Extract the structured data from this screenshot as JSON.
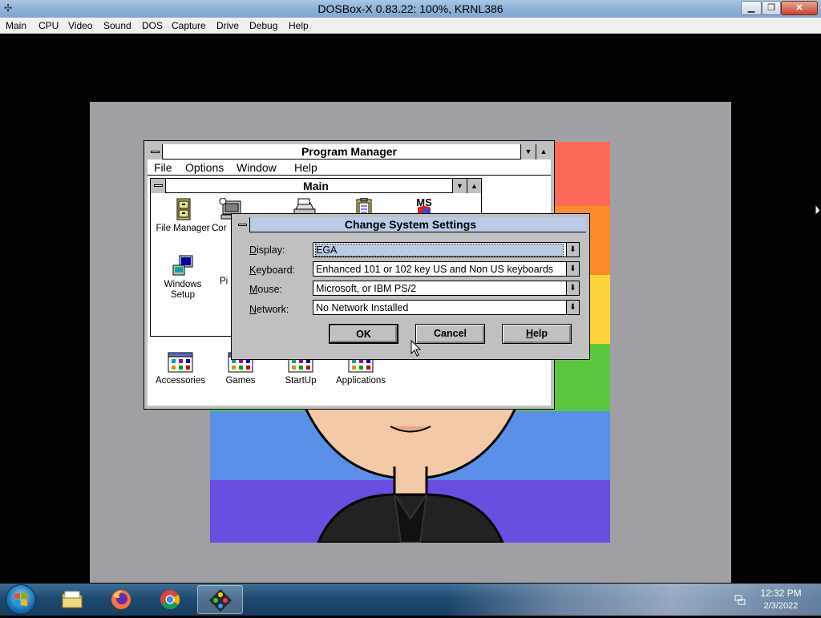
{
  "host": {
    "title": "DOSBox-X 0.83.22: 100%, KRNL386",
    "minimize_glyph": "▁",
    "maximize_glyph": "❐",
    "close_glyph": "✕",
    "menu": [
      "Main",
      "CPU",
      "Video",
      "Sound",
      "DOS",
      "Capture",
      "Drive",
      "Debug",
      "Help"
    ]
  },
  "progman": {
    "title": "Program Manager",
    "menu": [
      "File",
      "Options",
      "Window",
      "Help"
    ],
    "main_group": {
      "title": "Main",
      "icons": [
        {
          "label": "File Manager",
          "icon": "file-cabinet-icon"
        },
        {
          "label": "Cor",
          "icon": "computer-icon"
        },
        {
          "label": "",
          "icon": "printer-icon"
        },
        {
          "label": "",
          "icon": "clipboard-icon"
        },
        {
          "label": "",
          "icon": "ms-dos-icon"
        },
        {
          "label_line1": "Windows",
          "label_line2": "Setup",
          "icon": "windows-setup-icon"
        },
        {
          "label": "Pi",
          "icon": "pif-editor-icon"
        }
      ],
      "ms_dos_text": "MS"
    },
    "groups": [
      {
        "label": "Accessories",
        "icon": "program-group-icon"
      },
      {
        "label": "Games",
        "icon": "program-group-icon"
      },
      {
        "label": "StartUp",
        "icon": "program-group-icon"
      },
      {
        "label": "Applications",
        "icon": "program-group-icon"
      }
    ]
  },
  "dialog": {
    "title": "Change System Settings",
    "fields": [
      {
        "label_u": "D",
        "label_rest": "isplay:",
        "value": "EGA"
      },
      {
        "label_u": "K",
        "label_rest": "eyboard:",
        "value": "Enhanced 101 or 102 key US and Non US keyboards"
      },
      {
        "label_u": "M",
        "label_rest": "ouse:",
        "value": "Microsoft, or IBM PS/2"
      },
      {
        "label_u": "N",
        "label_rest": "etwork:",
        "value": "No Network Installed"
      }
    ],
    "buttons": {
      "ok": "OK",
      "cancel": "Cancel",
      "help_u": "H",
      "help_rest": "elp"
    }
  },
  "taskbar": {
    "clock_time": "12:32 PM",
    "clock_date": "2/3/2022",
    "apps": [
      {
        "name": "file-explorer",
        "icon": "folder-icon"
      },
      {
        "name": "firefox",
        "icon": "firefox-icon"
      },
      {
        "name": "chrome",
        "icon": "chrome-icon"
      },
      {
        "name": "dosbox",
        "icon": "dosbox-icon",
        "active": true
      }
    ]
  },
  "colors": {
    "wallpaper_stripes": [
      "#fd6a59",
      "#fb8b2b",
      "#fed33b",
      "#5cc73e",
      "#5a90e8",
      "#6b4ee0"
    ],
    "dialog_title": "#b9cbe6",
    "desktop": "#a0a0a4"
  }
}
